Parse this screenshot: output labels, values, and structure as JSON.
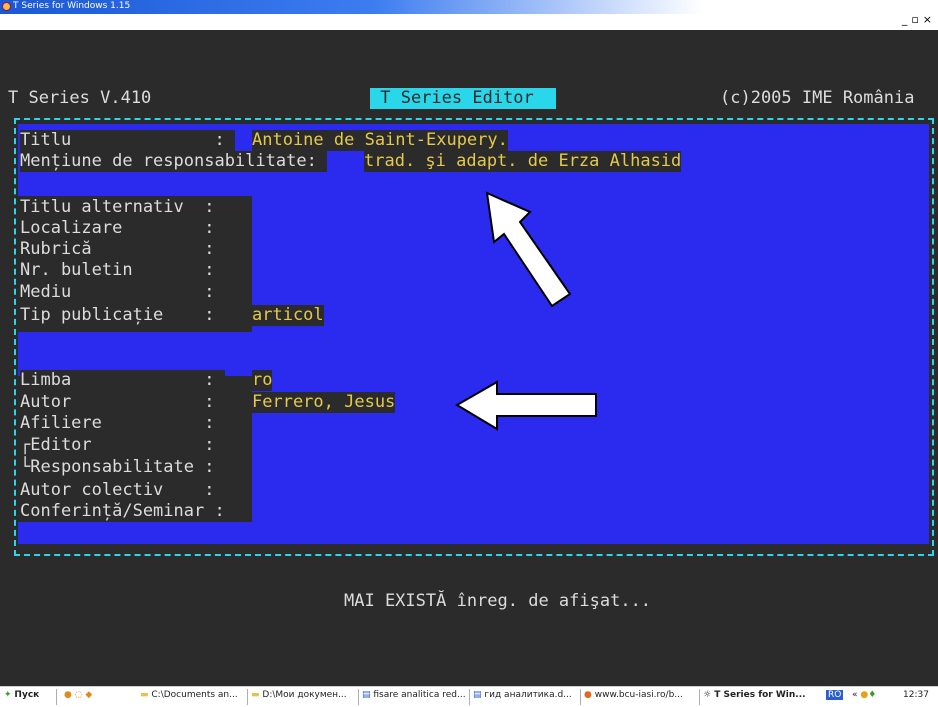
{
  "window": {
    "title": "T Series for Windows 1.15",
    "controls": [
      "_",
      "д",
      "×"
    ]
  },
  "header": {
    "left": "T Series V.410",
    "center": " T Series Editor",
    "right": "(c)2005 IME România"
  },
  "fields": {
    "titlu_label": "Titlu              : ",
    "titlu_value": "Antoine de Saint-Exupery.",
    "mentiune_label": "Mențiune de responsabilitate: ",
    "mentiune_value": "trad. şi adapt. de Erza Alhasid",
    "titlu_alternativ": "Titlu alternativ  : ",
    "localizare": "Localizare        : ",
    "rubrica": "Rubrică           : ",
    "nr_buletin": "Nr. buletin       : ",
    "mediu": "Mediu             : ",
    "tip_publicatie_label": "Tip publicație    : ",
    "tip_publicatie_value": "articol",
    "limba_label": "Limba             : ",
    "limba_value": "ro",
    "autor_label": "Autor             : ",
    "autor_value": "Ferrero, Jesus",
    "afiliere": "Afiliere          : ",
    "editor": "┌Editor           : ",
    "responsabilitate": "└Responsabilitate : ",
    "autor_colectiv": "Autor colectiv    : ",
    "conferinta": "Conferință/Seminar : "
  },
  "status_message": "MAI EXISTĂ înreg. de afişat...",
  "taskbar": {
    "start": "Пуск",
    "items": [
      "C:\\Documents an...",
      "D:\\Мои докумен...",
      "fisare analitica red...",
      "гид аналитика.d...",
      "www.bcu-iasi.ro/b...",
      "T Series for Win..."
    ],
    "lang": "RO",
    "clock": "12:37"
  },
  "colors": {
    "console_bg": "#2b2b2b",
    "field_blue": "#2b2bf0",
    "cyan": "#2ad7ea",
    "value_yellow": "#e5c94c",
    "label_gray": "#dcdcdc"
  }
}
